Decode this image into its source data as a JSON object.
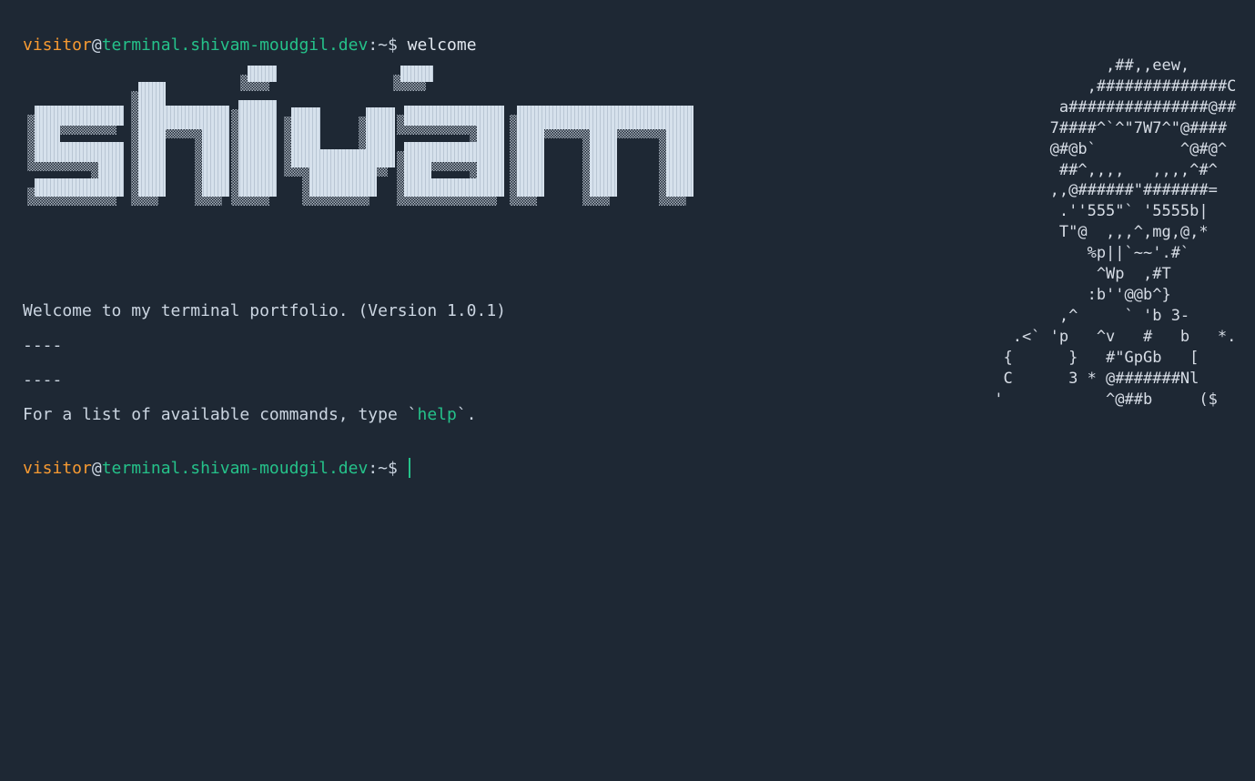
{
  "prompt": {
    "user": "visitor",
    "at": "@",
    "host": "terminal.shivam-moudgil.dev",
    "path": ":~$"
  },
  "first_command": "welcome",
  "banner_text": "shivam",
  "ascii_art": [
    "             ,##,,eew,",
    "           ,##############C",
    "        a###############@##",
    "       7####^`^\"7W7^\"@####",
    "       @#@b`         ^@#@^",
    "        ##^,,,,   ,,,,^#^",
    "       ,,@######\"#######=",
    "        .''555\"` '5555b|",
    "        T\"@  ,,,^,mg,@,*",
    "           %p||`~~'.#`",
    "            ^Wp  ,#T",
    "           :b''@@b^}",
    "        ,^     ` 'b 3-",
    "   .<` 'p   ^v   #   b   *.",
    "  {      }   #\"GpGb   [",
    "  C      3 * @#######Nl",
    " '           ^@##b     ($"
  ],
  "welcome_message": "Welcome to my terminal portfolio. (Version 1.0.1)",
  "separator_1": "----",
  "separator_2": "----",
  "help_hint": {
    "before": "For a list of available commands, type `",
    "command": "help",
    "after": "`."
  },
  "colors": {
    "background": "#1e2834",
    "user": "#f79a32",
    "host": "#25c28a",
    "text": "#cbd5e1"
  }
}
